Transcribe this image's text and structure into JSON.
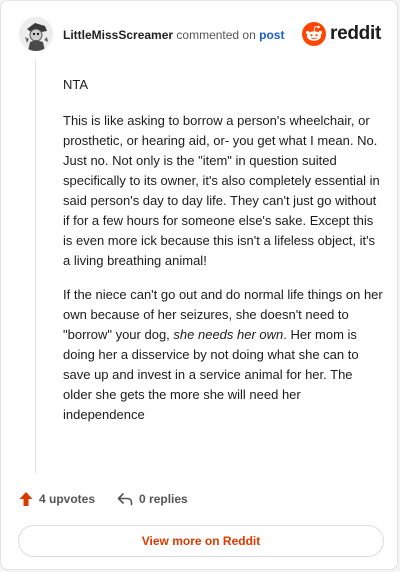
{
  "comment": {
    "author": "LittleMissScreamer",
    "action_text": "commented on",
    "post_link": "post",
    "brand_name": "reddit",
    "paragraphs": [
      "NTA",
      "This is like asking to borrow a person's wheelchair, or prosthetic, or hearing aid, or- you get what I mean. No. Just no. Not only is the \"item\" in question suited specifically to its owner, it's also completely essential in said person's day to day life. They can't just go without if for a few hours for someone else's sake. Except this is even more ick because this isn't a lifeless object, it's a living breathing animal!"
    ],
    "para3": {
      "before": "If the niece can't go out and do normal life things on her own because of her seizures, she doesn't need to \"borrow\" your dog, ",
      "emphasis": "she needs her own",
      "after": ". Her mom is doing her a disservice by not doing what she can to save up and invest in a service animal for her. The older she gets the more she will need her independence"
    }
  },
  "actions": {
    "upvotes": "4 upvotes",
    "replies": "0 replies"
  },
  "view_more_label": "View more on Reddit",
  "colors": {
    "accent": "#d93a00",
    "link": "#1a5fc8",
    "reddit_orange": "#ff4500"
  },
  "icons": [
    "avatar",
    "reddit-logo-icon",
    "upvote-icon",
    "reply-icon"
  ]
}
